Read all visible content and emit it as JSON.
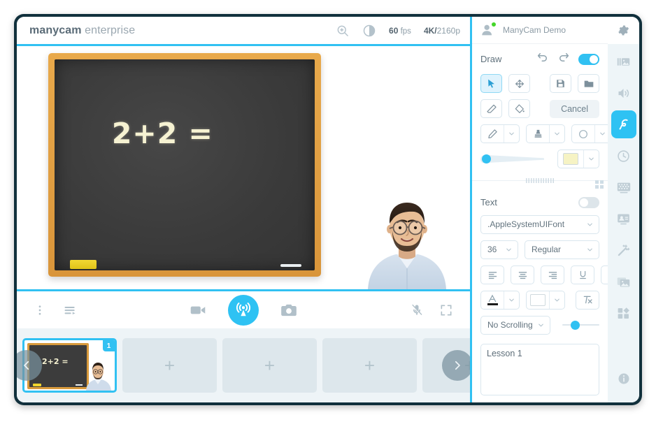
{
  "window": {
    "brand_bold": "manycam",
    "brand_light": " enterprise"
  },
  "titlebar": {
    "zoom_icon": "zoom-in-icon",
    "brightness_icon": "brightness-icon",
    "fps_value": "60",
    "fps_unit": "fps",
    "resolution_bold": "4K/",
    "resolution_light": "2160p"
  },
  "preview": {
    "board_equation": "2+2 =",
    "accent_color": "#31c1f2"
  },
  "controlbar": {
    "more_icon": "more-vertical-icon",
    "playlist_icon": "playlist-icon",
    "record_icon": "video-camera-icon",
    "broadcast_icon": "broadcast-icon",
    "snapshot_icon": "camera-icon",
    "mic_icon": "microphone-muted-icon",
    "fullscreen_icon": "fullscreen-icon"
  },
  "thumbnails": {
    "prev_icon": "chevron-left-icon",
    "next_icon": "chevron-right-icon",
    "items": [
      {
        "type": "preset",
        "badge": "1",
        "equation": "2+2 =",
        "active": true
      },
      {
        "type": "empty",
        "label": "+"
      },
      {
        "type": "empty",
        "label": "+"
      },
      {
        "type": "empty",
        "label": "+"
      },
      {
        "type": "empty",
        "label": "+"
      }
    ]
  },
  "properties": {
    "user": {
      "name": "ManyCam Demo",
      "avatar_icon": "user-avatar-icon",
      "status": "online"
    },
    "draw": {
      "title": "Draw",
      "undo_icon": "undo-icon",
      "redo_icon": "redo-icon",
      "enabled": true,
      "tools": {
        "select_icon": "cursor-arrow-icon",
        "move_icon": "move-arrows-icon",
        "eraser_icon": "eraser-icon",
        "fill_icon": "paint-bucket-icon",
        "save_icon": "save-disk-icon",
        "open_icon": "folder-icon"
      },
      "cancel_label": "Cancel",
      "pen_icon": "pencil-icon",
      "stamp_icon": "stamp-icon",
      "shape_icon": "circle-shape-icon",
      "chevron_icon": "chevron-down-icon",
      "size_slider_percent": 4,
      "color_swatch": "#f6f3c4"
    },
    "text": {
      "title": "Text",
      "enabled": false,
      "font_family": ".AppleSystemUIFont",
      "font_size": "36",
      "font_style": "Regular",
      "align_left_icon": "align-left-icon",
      "align_center_icon": "align-center-icon",
      "align_right_icon": "align-right-icon",
      "underline_icon": "underline-icon",
      "strikethrough_icon": "strikethrough-icon",
      "font_color_icon": "font-color-icon",
      "font_color": "#1b1b1b",
      "highlight_icon": "highlight-color-icon",
      "clear_format_icon": "clear-formatting-icon",
      "scrolling_mode": "No Scrolling",
      "speed_slider_percent": 30,
      "content": "Lesson 1"
    }
  },
  "rail": {
    "items": [
      {
        "icon": "gear-icon",
        "name": "settings",
        "selected": false
      },
      {
        "icon": "layers-media-icon",
        "name": "media-layers",
        "selected": false
      },
      {
        "icon": "speaker-icon",
        "name": "audio",
        "selected": false
      },
      {
        "icon": "draw-squiggle-icon",
        "name": "draw",
        "selected": true
      },
      {
        "icon": "clock-icon",
        "name": "scheduler",
        "selected": false
      },
      {
        "icon": "chroma-key-icon",
        "name": "chroma-key",
        "selected": false
      },
      {
        "icon": "lower-third-icon",
        "name": "lower-third",
        "selected": false
      },
      {
        "icon": "magic-wand-icon",
        "name": "effects",
        "selected": false
      },
      {
        "icon": "backgrounds-icon",
        "name": "backgrounds",
        "selected": false
      },
      {
        "icon": "objects-icon",
        "name": "objects",
        "selected": false
      },
      {
        "icon": "info-icon",
        "name": "info",
        "selected": false
      }
    ]
  }
}
